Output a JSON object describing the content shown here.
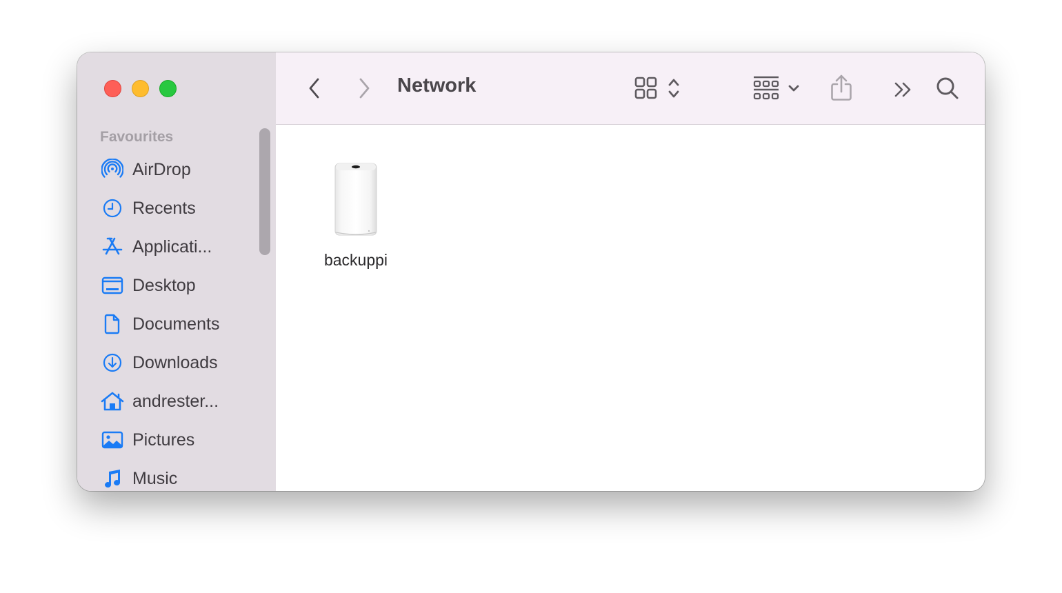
{
  "window": {
    "traffic_lights": [
      {
        "name": "close",
        "color": "#fe5f57"
      },
      {
        "name": "minimize",
        "color": "#febc2e"
      },
      {
        "name": "zoom",
        "color": "#28c840"
      }
    ]
  },
  "sidebar": {
    "section_title": "Favourites",
    "accent_color": "#1a7bf5",
    "items": [
      {
        "label": "AirDrop",
        "icon": "airdrop-icon"
      },
      {
        "label": "Recents",
        "icon": "clock-icon"
      },
      {
        "label": "Applicati...",
        "icon": "applications-icon"
      },
      {
        "label": "Desktop",
        "icon": "desktop-icon"
      },
      {
        "label": "Documents",
        "icon": "document-icon"
      },
      {
        "label": "Downloads",
        "icon": "download-icon"
      },
      {
        "label": "andrester...",
        "icon": "home-icon"
      },
      {
        "label": "Pictures",
        "icon": "pictures-icon"
      },
      {
        "label": "Music",
        "icon": "music-icon"
      }
    ]
  },
  "toolbar": {
    "title": "Network",
    "back_icon": "chevron-left-icon",
    "forward_icon": "chevron-right-icon",
    "view_icon": "icon-grid-view-icon",
    "group_icon": "group-by-icon",
    "share_icon": "share-icon",
    "more_icon": "double-chevron-right-icon",
    "search_icon": "search-icon"
  },
  "content": {
    "items": [
      {
        "label": "backuppi",
        "icon": "airport-time-capsule-icon"
      }
    ]
  }
}
